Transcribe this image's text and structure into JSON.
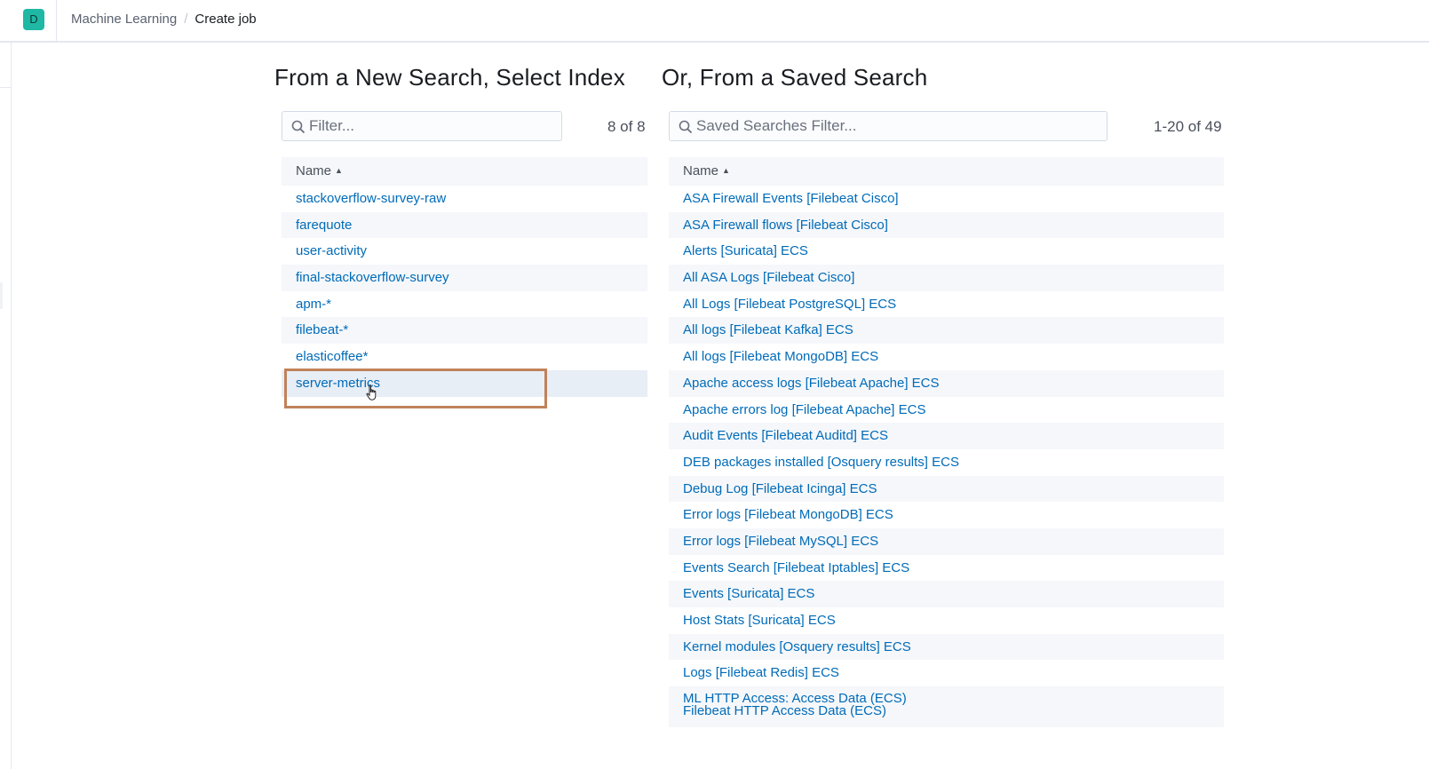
{
  "header": {
    "space_initial": "D",
    "breadcrumbs": [
      "Machine Learning",
      "Create job"
    ],
    "separator": "/"
  },
  "index_panel": {
    "title": "From a New Search, Select Index",
    "filter_placeholder": "Filter...",
    "count": "8 of 8",
    "column_header": "Name",
    "rows": [
      "stackoverflow-survey-raw",
      "farequote",
      "user-activity",
      "final-stackoverflow-survey",
      "apm-*",
      "filebeat-*",
      "elasticoffee*",
      "server-metrics"
    ],
    "selected_row": "server-metrics"
  },
  "saved_panel": {
    "title": "Or, From a Saved Search",
    "filter_placeholder": "Saved Searches Filter...",
    "count": "1-20 of 49",
    "column_header": "Name",
    "rows": [
      "ASA Firewall Events [Filebeat Cisco]",
      "ASA Firewall flows [Filebeat Cisco]",
      "Alerts [Suricata] ECS",
      "All ASA Logs [Filebeat Cisco]",
      "All Logs [Filebeat PostgreSQL] ECS",
      "All logs [Filebeat Kafka] ECS",
      "All logs [Filebeat MongoDB] ECS",
      "Apache access logs [Filebeat Apache] ECS",
      "Apache errors log [Filebeat Apache] ECS",
      "Audit Events [Filebeat Auditd] ECS",
      "DEB packages installed [Osquery results] ECS",
      "Debug Log [Filebeat Icinga] ECS",
      "Error logs [Filebeat MongoDB] ECS",
      "Error logs [Filebeat MySQL] ECS",
      "Events Search [Filebeat Iptables] ECS",
      "Events [Suricata] ECS",
      "Host Stats [Suricata] ECS",
      "Kernel modules [Osquery results] ECS",
      "Logs [Filebeat Redis] ECS",
      "ML HTTP Access: Access Data (ECS)\nFilebeat HTTP Access Data (ECS)"
    ]
  },
  "colors": {
    "link": "#006bb8",
    "row_stripe": "#f5f7fa",
    "highlight_box": "#c0825a",
    "space_avatar": "#1fb8a4"
  },
  "icons": [
    "search-icon",
    "sort-ascending-icon",
    "pointer-hand-icon"
  ]
}
